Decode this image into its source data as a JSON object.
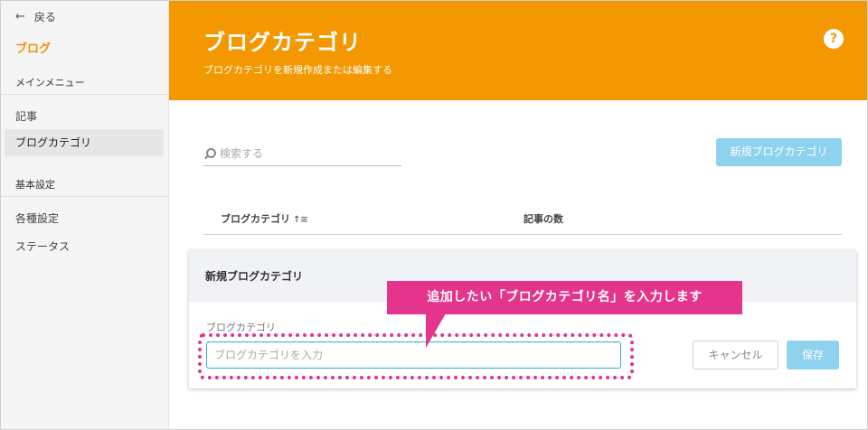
{
  "sidebar": {
    "back_label": "戻る",
    "title": "ブログ",
    "main_menu_label": "メインメニュー",
    "items_main": [
      {
        "label": "記事"
      },
      {
        "label": "ブログカテゴリ",
        "active": true
      }
    ],
    "basic_settings_label": "基本設定",
    "items_settings": [
      {
        "label": "各種設定"
      },
      {
        "label": "ステータス"
      }
    ]
  },
  "header": {
    "title": "ブログカテゴリ",
    "subtitle": "ブログカテゴリを新規作成または編集する",
    "help_icon": "?",
    "bg_color": "#f39800"
  },
  "search": {
    "placeholder": "検索する"
  },
  "new_button_label": "新規ブログカテゴリ",
  "table": {
    "columns": [
      "ブログカテゴリ",
      "記事の数"
    ]
  },
  "card": {
    "title": "新規ブログカテゴリ",
    "field_label": "ブログカテゴリ",
    "input_placeholder": "ブログカテゴリを入力",
    "cancel_label": "キャンセル",
    "save_label": "保存"
  },
  "annotation": {
    "text": "追加したい「ブログカテゴリ名」を入力します",
    "color": "#e4348b"
  }
}
